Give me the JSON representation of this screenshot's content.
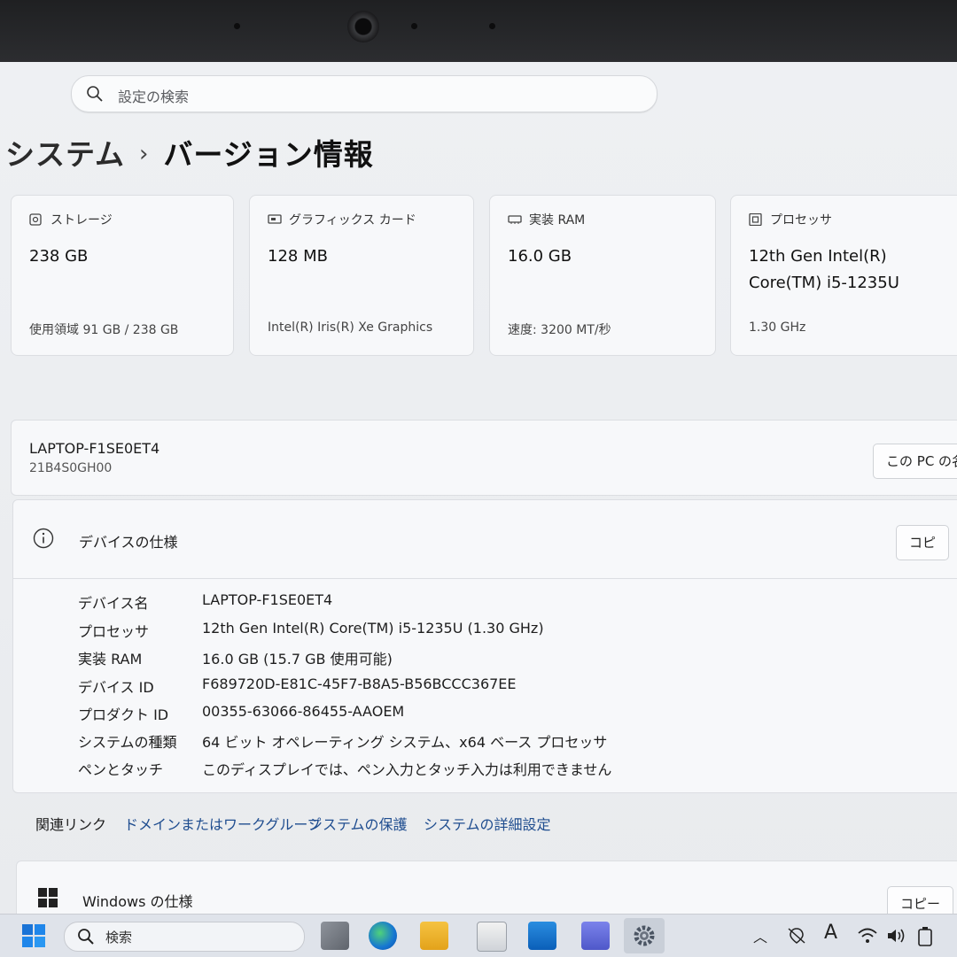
{
  "search": {
    "placeholder": "設定の検索"
  },
  "breadcrumb": {
    "parent": "システム",
    "separator": "›",
    "current": "バージョン情報"
  },
  "cards": [
    {
      "icon": "storage-icon",
      "label": "ストレージ",
      "value": "238 GB",
      "value2": "",
      "sub": "使用領域 91 GB / 238 GB"
    },
    {
      "icon": "gpu-icon",
      "label": "グラフィックス カード",
      "value": "128 MB",
      "value2": "",
      "sub": "Intel(R) Iris(R) Xe Graphics"
    },
    {
      "icon": "ram-icon",
      "label": "実装 RAM",
      "value": "16.0 GB",
      "value2": "",
      "sub": "速度: 3200 MT/秒"
    },
    {
      "icon": "processor-icon",
      "label": "プロセッサ",
      "value": "12th Gen Intel(R)",
      "value2": "Core(TM) i5-1235U",
      "sub": "1.30 GHz"
    }
  ],
  "device": {
    "name": "LAPTOP-F1SE0ET4",
    "model": "21B4S0GH00",
    "rename_button": "この PC の名"
  },
  "device_spec": {
    "title": "デバイスの仕様",
    "copy_button": "コピ",
    "rows": [
      {
        "key": "デバイス名",
        "value": "LAPTOP-F1SE0ET4"
      },
      {
        "key": "プロセッサ",
        "value": "12th Gen Intel(R) Core(TM) i5-1235U (1.30 GHz)"
      },
      {
        "key": "実装 RAM",
        "value": "16.0 GB (15.7 GB 使用可能)"
      },
      {
        "key": "デバイス ID",
        "value": "F689720D-E81C-45F7-B8A5-B56BCCC367EE"
      },
      {
        "key": "プロダクト ID",
        "value": "00355-63066-86455-AAOEM"
      },
      {
        "key": "システムの種類",
        "value": "64 ビット オペレーティング システム、x64 ベース プロセッサ"
      },
      {
        "key": "ペンとタッチ",
        "value": "このディスプレイでは、ペン入力とタッチ入力は利用できません"
      }
    ]
  },
  "related_links": {
    "label": "関連リンク",
    "items": [
      "ドメインまたはワークグループ",
      "システムの保護",
      "システムの詳細設定"
    ]
  },
  "windows_spec": {
    "title": "Windows の仕様",
    "copy_button": "コピー"
  },
  "taskbar": {
    "search_placeholder": "検索",
    "ime_indicator": "A"
  },
  "colors": {
    "accent": "#1f4d8f",
    "background": "#eceef1",
    "card": "#f7f8fa",
    "taskbar": "#dfe3ea"
  }
}
